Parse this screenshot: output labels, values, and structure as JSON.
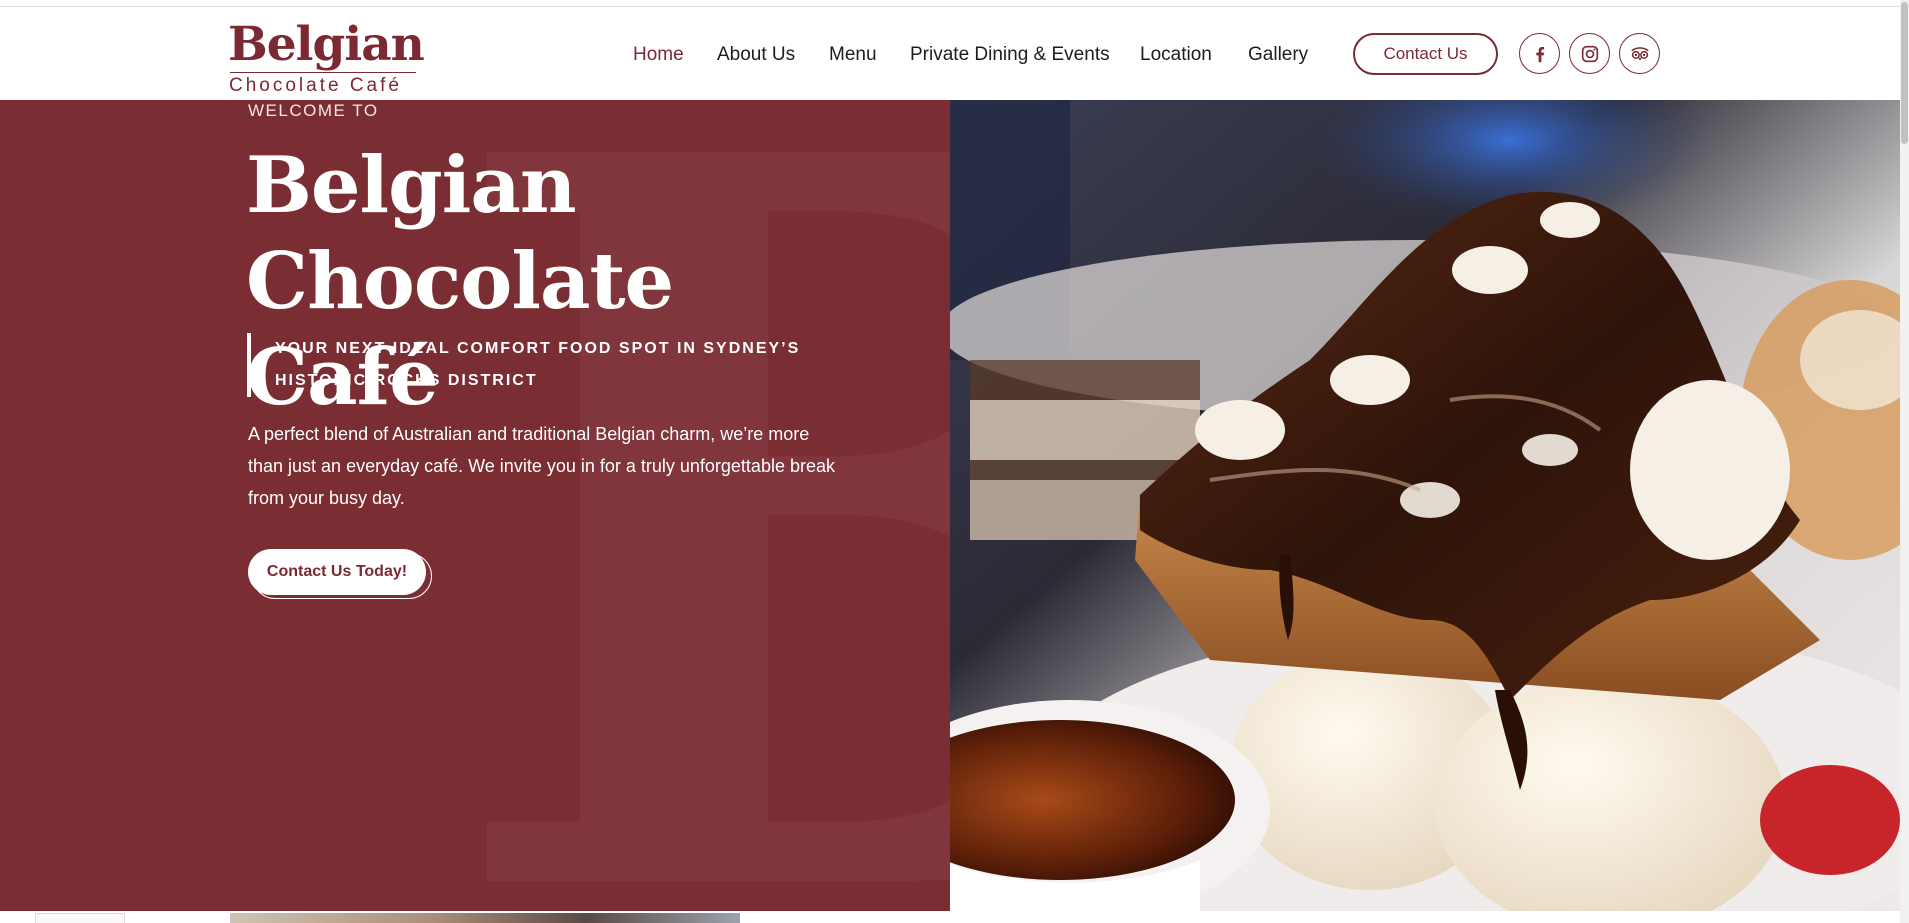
{
  "brand": {
    "name_main": "Belgian",
    "name_sub": "Chocolate Café",
    "color": "#7b2a33",
    "hero_bg": "#7b2d34"
  },
  "nav": {
    "items": [
      {
        "label": "Home",
        "active": true
      },
      {
        "label": "About Us",
        "active": false
      },
      {
        "label": "Menu",
        "active": false
      },
      {
        "label": "Private Dining & Events",
        "active": false
      },
      {
        "label": "Location",
        "active": false
      },
      {
        "label": "Gallery",
        "active": false
      }
    ],
    "contact_label": "Contact Us",
    "social": [
      {
        "icon": "facebook-icon"
      },
      {
        "icon": "instagram-icon"
      },
      {
        "icon": "tripadvisor-icon"
      }
    ]
  },
  "hero": {
    "welcome": "WELCOME TO",
    "title_line1": "Belgian",
    "title_line2": "Chocolate Café",
    "tagline_line1": "YOUR NEXT IDEAL COMFORT FOOD SPOT IN SYDNEY’S",
    "tagline_line2": "HISTORIC ROCKS DISTRICT",
    "description": "A perfect blend of Australian and traditional Belgian charm, we’re more than just an everyday café. We invite you in for a truly unforgettable break from your busy day.",
    "cta_label": "Contact Us Today!"
  }
}
